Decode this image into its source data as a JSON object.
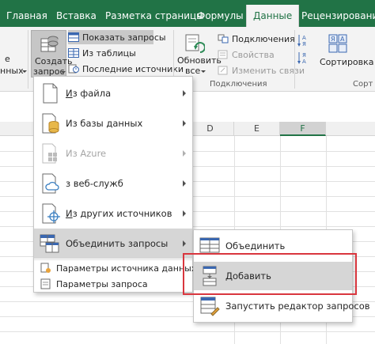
{
  "tabs": [
    {
      "label": "Главная"
    },
    {
      "label": "Вставка"
    },
    {
      "label": "Разметка страницы"
    },
    {
      "label": "Формулы"
    },
    {
      "label": "Данные",
      "active": true
    },
    {
      "label": "Рецензирование"
    }
  ],
  "ribbon": {
    "left_cut_top": "е",
    "left_cut_bottom": "нных",
    "create_query": {
      "line1": "Создать",
      "line2": "запрос"
    },
    "show_queries": "Показать запросы",
    "from_table": "Из таблицы",
    "recent_sources": "Последние источники",
    "refresh": {
      "line1": "Обновить",
      "line2": "все"
    },
    "connections": "Подключения",
    "properties": "Свойства",
    "edit_links": "Изменить связи",
    "group_connections": "Подключения",
    "sort": "Сортировка",
    "group_sort_cut": "Сорт",
    "accent_color": "#217346"
  },
  "columns": [
    {
      "label": "D"
    },
    {
      "label": "E"
    },
    {
      "label": "F",
      "selected": true
    }
  ],
  "main_menu": {
    "items": [
      {
        "label": "Из файла",
        "icon": "file-icon",
        "submenu": true,
        "disabled": false
      },
      {
        "label": "Из базы данных",
        "icon": "database-icon",
        "submenu": true,
        "disabled": false
      },
      {
        "label": "Из Azure",
        "icon": "azure-icon",
        "submenu": true,
        "disabled": true
      },
      {
        "label": "з веб-служб",
        "icon": "cloud-icon",
        "submenu": true,
        "disabled": false
      },
      {
        "label": "Из других источников",
        "icon": "other-sources-icon",
        "submenu": true,
        "disabled": false
      },
      {
        "label": "Объединить запросы",
        "icon": "combine-queries-icon",
        "submenu": true,
        "disabled": false,
        "highlighted": true
      }
    ],
    "footer": [
      {
        "label": "Параметры источника данных...",
        "icon": "data-source-settings-icon"
      },
      {
        "label": "Параметры запроса",
        "icon": "query-options-icon"
      }
    ]
  },
  "sub_menu": {
    "items": [
      {
        "label": "Объединить",
        "icon": "merge-icon"
      },
      {
        "label": "Добавить",
        "icon": "append-icon",
        "highlighted": true
      },
      {
        "label": "Запустить редактор запросов",
        "icon": "query-editor-icon"
      }
    ]
  },
  "highlight_color": "#d9363e"
}
